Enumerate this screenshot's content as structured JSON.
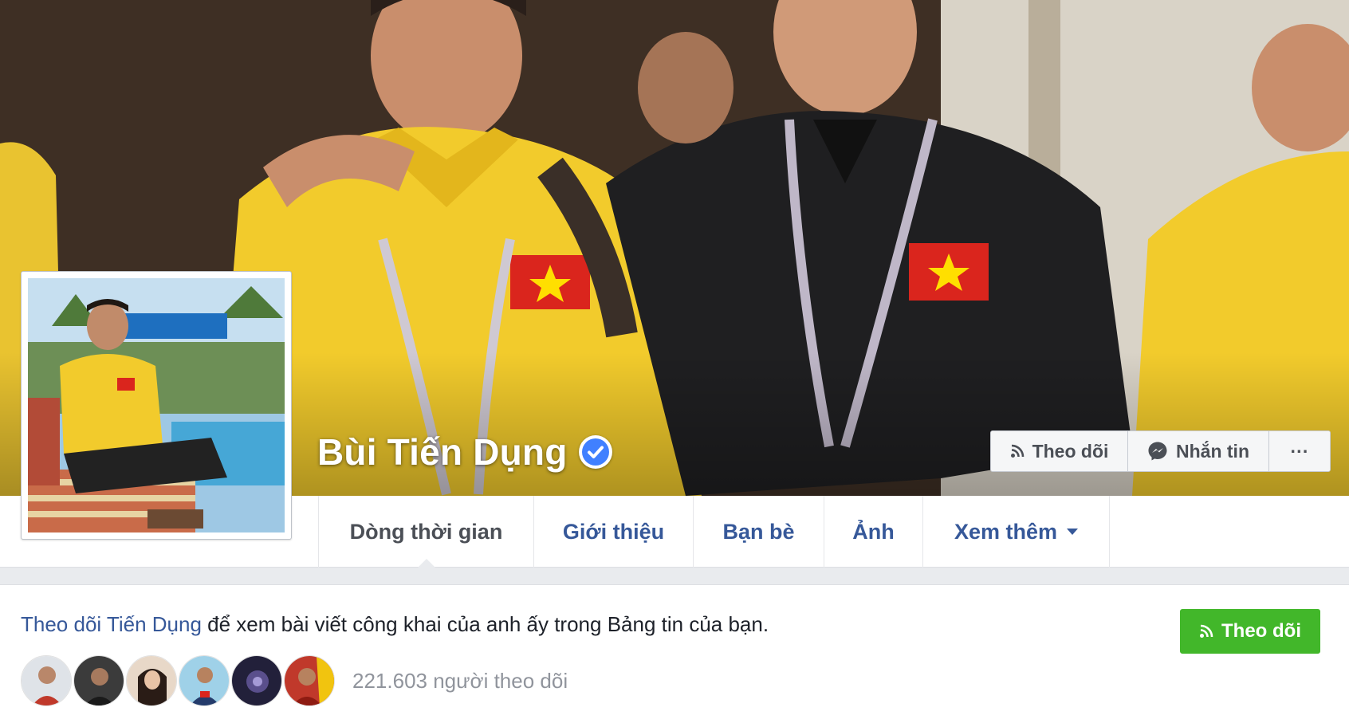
{
  "profile": {
    "name": "Bùi Tiến Dụng",
    "verified": true
  },
  "cover_actions": {
    "follow_label": "Theo dõi",
    "message_label": "Nhắn tin",
    "more_label": "···"
  },
  "nav": {
    "tabs": [
      {
        "label": "Dòng thời gian",
        "active": true
      },
      {
        "label": "Giới thiệu",
        "active": false
      },
      {
        "label": "Bạn bè",
        "active": false
      },
      {
        "label": "Ảnh",
        "active": false
      },
      {
        "label": "Xem thêm",
        "active": false,
        "has_dropdown": true
      }
    ]
  },
  "follow_panel": {
    "link_text": "Theo dõi Tiến Dụng",
    "rest_text": " để xem bài viết công khai của anh ấy trong Bảng tin của bạn.",
    "button_label": "Theo dõi",
    "followers_count": "221.603 người theo dõi"
  },
  "colors": {
    "link_blue": "#365899",
    "follow_green": "#42b72a",
    "verified_blue": "#4080ff",
    "muted_text": "#90949c"
  },
  "icons": {
    "follow": "rss-icon",
    "message": "messenger-icon",
    "verified": "verified-check-icon",
    "dropdown": "caret-down-icon"
  }
}
